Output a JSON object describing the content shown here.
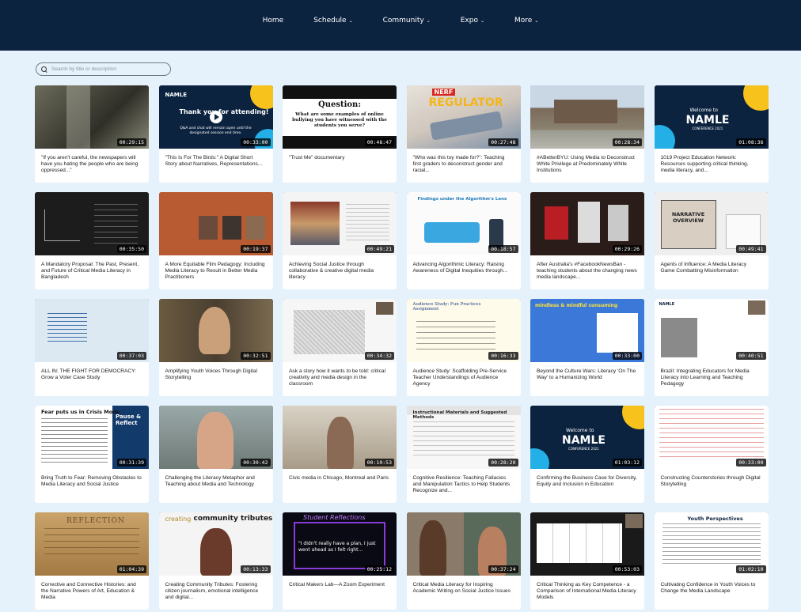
{
  "nav": [
    {
      "label": "Home",
      "dropdown": false
    },
    {
      "label": "Schedule",
      "dropdown": true
    },
    {
      "label": "Community",
      "dropdown": true
    },
    {
      "label": "Expo",
      "dropdown": true
    },
    {
      "label": "More",
      "dropdown": true
    }
  ],
  "search": {
    "placeholder": "Search by title or description"
  },
  "thumb_text": {
    "namle": "NAMLE",
    "thanks": "Thank you for attending!",
    "thanks_sub": "Q&A and chat will remain open until the designated session end time.",
    "question_title": "Question:",
    "question_body": "What are some examples of online bullying you have witnessed with the students you serve?",
    "nerf": "NERF",
    "regulator": "REGULATOR",
    "welcome": "Welcome to",
    "conference": "CONFERENCE 2021",
    "narrative": "NARRATIVE OVERVIEW",
    "fear_title": "Fear puts us in Crisis Mode",
    "pause": "Pause & Reflect",
    "reflection": "REFLECTION",
    "creating": "creating",
    "community_tributes": "community tributes",
    "student_reflections": "Student Reflections",
    "quote": "\"I didn't really have a plan, I just went ahead as I felt right...",
    "youth": "Youth Perspectives",
    "mindless": "mindless & mindful consuming",
    "audience_study": "Audience Study: Fun Practices Assignment",
    "instructional": "Instructional Materials and Suggested Methods",
    "findings": "Findings under the Algorithm's Lens"
  },
  "videos": [
    {
      "title": "\"If you aren't careful, the newspapers will have you hating the people who are being oppressed...\"",
      "duration": "00:29:15"
    },
    {
      "title": "\"This Is For The Birds:\" A Digital Short Story about Narratives, Representations...",
      "duration": "00:33:00"
    },
    {
      "title": "\"Trust Me\" documentary",
      "duration": "00:48:47"
    },
    {
      "title": "\"Who was this toy made for?\": Teaching first graders to deconstruct gender and racial...",
      "duration": "00:27:48"
    },
    {
      "title": "#ABetterBYU: Using Media to Deconstruct White Privilege at Predominately White Institutions",
      "duration": "00:28:34"
    },
    {
      "title": "1019 Project Education Network: Resources supporting critical thinking, media literacy, and...",
      "duration": "01:08:36"
    },
    {
      "title": "A Mandatory Proposal: The Past, Present, and Future of Critical Media Literacy in Bangladesh",
      "duration": "00:35:50"
    },
    {
      "title": "A More Equitable Film Pedagogy: Including Media Literacy to Result in Better Media Practitioners",
      "duration": "00:19:37"
    },
    {
      "title": "Achieving Social Justice through collaborative & creative digital media literacy",
      "duration": "00:49:21"
    },
    {
      "title": "Advancing Algorithmic Literacy: Raising Awareness of Digital Inequities through...",
      "duration": "00:18:57"
    },
    {
      "title": "After Australia's #FacebookNewsBan - teaching students about the changing news media landscape...",
      "duration": "00:29:26"
    },
    {
      "title": "Agents of Influence: A Media Literacy Game Combatting Misinformation",
      "duration": "00:49:41"
    },
    {
      "title": "ALL IN: THE FIGHT FOR DEMOCRACY: Grow a Voter Case Study",
      "duration": "00:37:03"
    },
    {
      "title": "Amplifying Youth Voices Through Digital Storytelling",
      "duration": "00:32:51"
    },
    {
      "title": "Ask a story how it wants to be told: critical creativity and media design in the classroom",
      "duration": "00:34:32"
    },
    {
      "title": "Audience Study: Scaffolding Pre-Service Teacher Understandings of Audience Agency",
      "duration": "00:16:33"
    },
    {
      "title": "Beyond the Culture Wars: Literacy 'On The Way' to a Humanizing World",
      "duration": "00:33:00"
    },
    {
      "title": "Brazil: Integrating Educators for Media Literacy into Learning and Teaching Pedagogy",
      "duration": "00:40:51"
    },
    {
      "title": "Bring Truth to Fear: Removing Obstacles to Media Literacy and Social Justice",
      "duration": "00:31:39"
    },
    {
      "title": "Challenging the Literacy Metaphor and Teaching about Media and Technology",
      "duration": "00:30:42"
    },
    {
      "title": "Civic media in Chicago, Montreal and Paris",
      "duration": "00:10:53"
    },
    {
      "title": "Cognitive Resilience: Teaching Fallacies and Manipulation Tactics to Help Students Recognize and...",
      "duration": "00:28:20"
    },
    {
      "title": "Confirming the Business Case for Diversity, Equity and Inclusion in Education",
      "duration": "01:03:12"
    },
    {
      "title": "Constructing Counterstories through Digital Storytelling",
      "duration": "00:33:00"
    },
    {
      "title": "Corrective and Connective Histories: and the Narrative Powers of Art, Education & Media",
      "duration": "01:04:39"
    },
    {
      "title": "Creating Community Tributes: Fostering citizen journalism, emotional intelligence and digital...",
      "duration": "00:13:33"
    },
    {
      "title": "Critical Makers Lab—A Zoom Experiment",
      "duration": "00:25:12"
    },
    {
      "title": "Critical Media Literacy for Inspiring Academic Writing on Social Justice Issues",
      "duration": "00:37:24"
    },
    {
      "title": "Critical Thinking as Key Competence - a Comparison of International Media Literacy Models",
      "duration": "00:53:03"
    },
    {
      "title": "Cultivating Confidence in Youth Voices to Change the Media Landscape",
      "duration": "01:02:10"
    }
  ]
}
